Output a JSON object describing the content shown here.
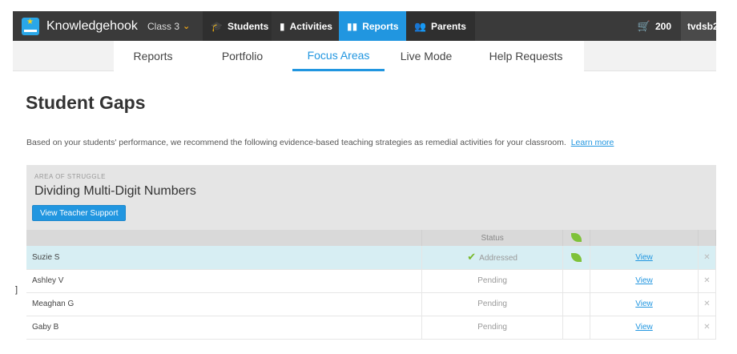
{
  "topnav": {
    "brand": "Knowledgehook",
    "class_label": "Class 3",
    "items": [
      {
        "label": "Students",
        "icon": "graduation-cap-icon"
      },
      {
        "label": "Activities",
        "icon": "book-icon"
      },
      {
        "label": "Reports",
        "icon": "bar-chart-icon"
      },
      {
        "label": "Parents",
        "icon": "users-icon"
      }
    ],
    "cart_count": "200",
    "user": "tvdsb2"
  },
  "subnav": {
    "tabs": [
      "Reports",
      "Portfolio",
      "Focus Areas",
      "Live Mode",
      "Help Requests"
    ],
    "active": "Focus Areas"
  },
  "page": {
    "title": "Student Gaps",
    "intro": "Based on your students' performance, we recommend the following evidence-based teaching strategies as remedial activities for your classroom.",
    "learn_more": "Learn more"
  },
  "card": {
    "kicker": "AREA OF STRUGGLE",
    "struggle": "Dividing Multi-Digit Numbers",
    "button": "View Teacher Support",
    "table": {
      "status_header": "Status",
      "rows": [
        {
          "name": "Suzie S",
          "status": "Addressed",
          "view": "View"
        },
        {
          "name": "Ashley V",
          "status": "Pending",
          "view": "View"
        },
        {
          "name": "Meaghan G",
          "status": "Pending",
          "view": "View"
        },
        {
          "name": "Gaby B",
          "status": "Pending",
          "view": "View"
        }
      ]
    }
  },
  "colors": {
    "nav_bg": "#3a3a3a",
    "accent": "#2196e0",
    "highlight_row": "#d7eef3",
    "leaf": "#7fc23a"
  }
}
